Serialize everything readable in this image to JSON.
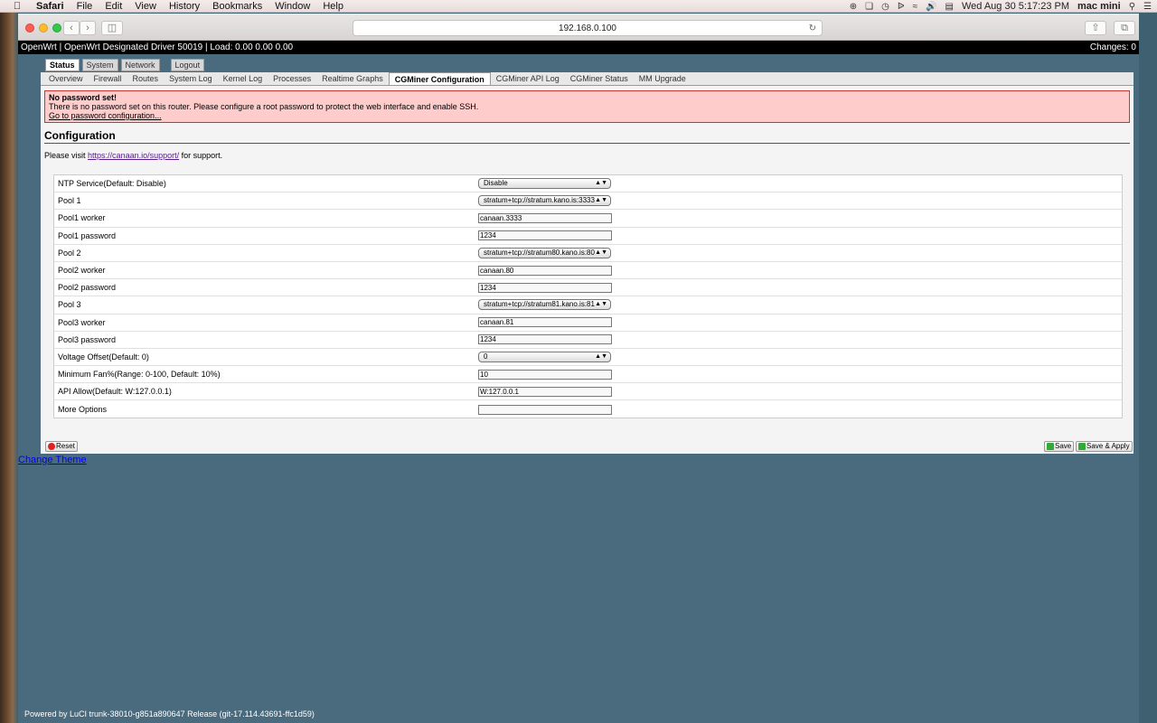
{
  "menubar": {
    "app": "Safari",
    "items": [
      "File",
      "Edit",
      "View",
      "History",
      "Bookmarks",
      "Window",
      "Help"
    ],
    "datetime": "Wed Aug 30  5:17:23 PM",
    "user": "mac mini"
  },
  "browser": {
    "url": "192.168.0.100"
  },
  "header": {
    "title": "OpenWrt | OpenWrt Designated Driver 50019 | Load: 0.00 0.00 0.00",
    "changes": "Changes: 0"
  },
  "top_tabs": [
    "Status",
    "System",
    "Network",
    "Logout"
  ],
  "sub_tabs": [
    "Overview",
    "Firewall",
    "Routes",
    "System Log",
    "Kernel Log",
    "Processes",
    "Realtime Graphs",
    "CGMiner Configuration",
    "CGMiner API Log",
    "CGMiner Status",
    "MM Upgrade"
  ],
  "alert": {
    "title": "No password set!",
    "message": "There is no password set on this router. Please configure a root password to protect the web interface and enable SSH.",
    "link": "Go to password configuration..."
  },
  "config": {
    "title": "Configuration",
    "support_prefix": "Please visit",
    "support_url": "https://canaan.io/support/",
    "support_suffix": "for support."
  },
  "fields": [
    {
      "label": "NTP Service(Default: Disable)",
      "type": "select",
      "value": "Disable"
    },
    {
      "label": "Pool 1",
      "type": "select",
      "value": "stratum+tcp://stratum.kano.is:3333"
    },
    {
      "label": "Pool1 worker",
      "type": "input",
      "value": "canaan.3333"
    },
    {
      "label": "Pool1 password",
      "type": "input",
      "value": "1234"
    },
    {
      "label": "Pool 2",
      "type": "select",
      "value": "stratum+tcp://stratum80.kano.is:80"
    },
    {
      "label": "Pool2 worker",
      "type": "input",
      "value": "canaan.80"
    },
    {
      "label": "Pool2 password",
      "type": "input",
      "value": "1234"
    },
    {
      "label": "Pool 3",
      "type": "select",
      "value": "stratum+tcp://stratum81.kano.is:81"
    },
    {
      "label": "Pool3 worker",
      "type": "input",
      "value": "canaan.81"
    },
    {
      "label": "Pool3 password",
      "type": "input",
      "value": "1234"
    },
    {
      "label": "Voltage Offset(Default: 0)",
      "type": "select",
      "value": "0"
    },
    {
      "label": "Minimum Fan%(Range: 0-100, Default: 10%)",
      "type": "input",
      "value": "10"
    },
    {
      "label": "API Allow(Default: W:127.0.0.1)",
      "type": "input",
      "value": "W:127.0.0.1"
    },
    {
      "label": "More Options",
      "type": "input",
      "value": ""
    }
  ],
  "buttons": {
    "reset": "Reset",
    "save": "Save",
    "save_apply": "Save & Apply"
  },
  "change_theme": "Change Theme",
  "powered_by": "Powered by LuCI trunk-38010-g851a890647 Release (git-17.114.43691-ffc1d59)"
}
